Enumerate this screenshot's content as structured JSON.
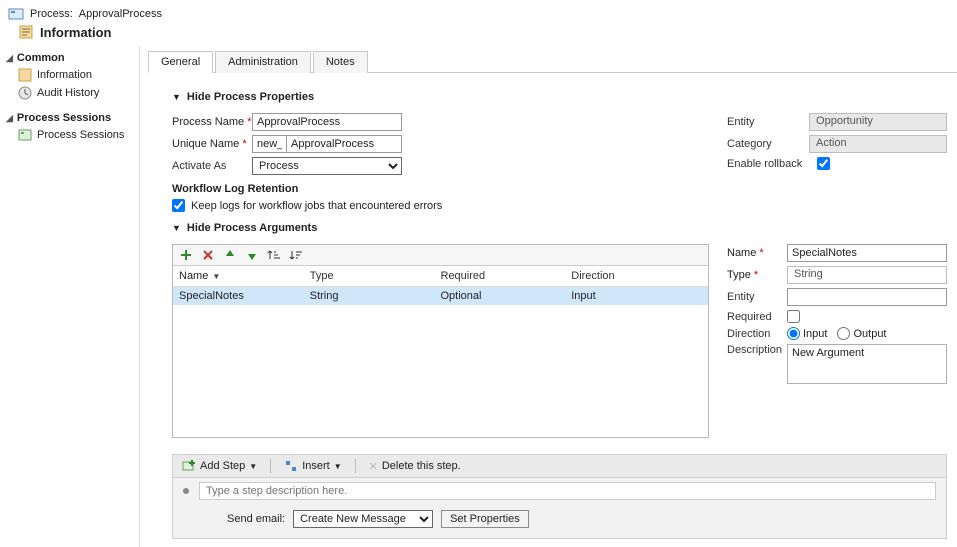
{
  "header": {
    "process_prefix": "Process:",
    "process_name": "ApprovalProcess",
    "subtitle": "Information"
  },
  "sidebar": {
    "sections": [
      {
        "title": "Common",
        "items": [
          {
            "label": "Information",
            "icon": "info-icon"
          },
          {
            "label": "Audit History",
            "icon": "history-icon"
          }
        ]
      },
      {
        "title": "Process Sessions",
        "items": [
          {
            "label": "Process Sessions",
            "icon": "sessions-icon"
          }
        ]
      }
    ]
  },
  "tabs": [
    {
      "label": "General",
      "active": true
    },
    {
      "label": "Administration",
      "active": false
    },
    {
      "label": "Notes",
      "active": false
    }
  ],
  "properties_section": {
    "title": "Hide Process Properties"
  },
  "form": {
    "process_name_label": "Process Name",
    "process_name_value": "ApprovalProcess",
    "unique_name_label": "Unique Name",
    "unique_name_prefix": "new_",
    "unique_name_value": "ApprovalProcess",
    "activate_as_label": "Activate As",
    "activate_as_value": "Process",
    "entity_label": "Entity",
    "entity_value": "Opportunity",
    "category_label": "Category",
    "category_value": "Action",
    "enable_rollback_label": "Enable rollback",
    "enable_rollback_checked": true,
    "workflow_log_heading": "Workflow Log Retention",
    "workflow_log_option": "Keep logs for workflow jobs that encountered errors",
    "workflow_log_checked": true
  },
  "arguments_section": {
    "title": "Hide Process Arguments"
  },
  "arg_grid": {
    "columns": {
      "name": "Name",
      "type": "Type",
      "required": "Required",
      "direction": "Direction"
    },
    "rows": [
      {
        "name": "SpecialNotes",
        "type": "String",
        "required": "Optional",
        "direction": "Input"
      }
    ]
  },
  "arg_detail": {
    "name_label": "Name",
    "name_value": "SpecialNotes",
    "type_label": "Type",
    "type_value": "String",
    "entity_label": "Entity",
    "entity_value": "",
    "required_label": "Required",
    "required_checked": false,
    "direction_label": "Direction",
    "direction_input": "Input",
    "direction_output": "Output",
    "description_label": "Description",
    "description_value": "New Argument"
  },
  "steps": {
    "add_step": "Add Step",
    "insert": "Insert",
    "delete": "Delete this step.",
    "placeholder": "Type a step description here.",
    "send_email_label": "Send email:",
    "send_email_value": "Create New Message",
    "set_properties": "Set Properties"
  }
}
